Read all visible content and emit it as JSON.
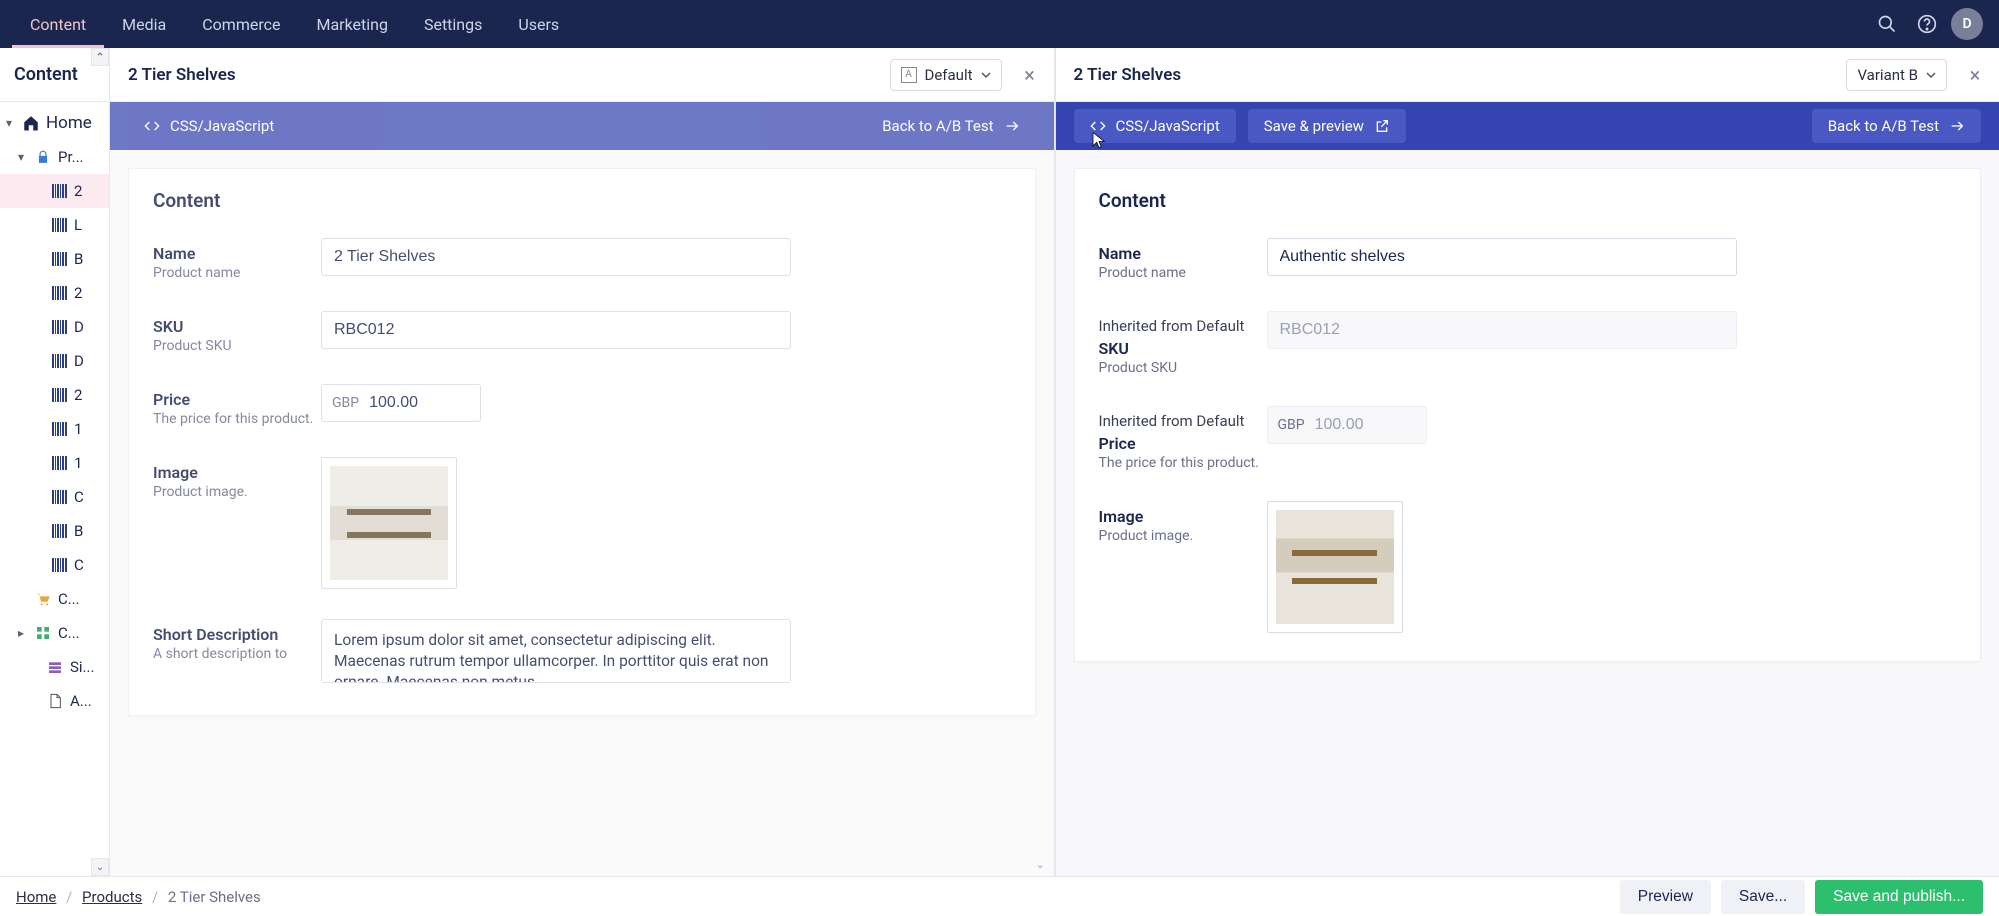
{
  "topnav": {
    "items": [
      "Content",
      "Media",
      "Commerce",
      "Marketing",
      "Settings",
      "Users"
    ],
    "active": 0,
    "avatar_initial": "D"
  },
  "sidebar": {
    "title": "Content",
    "home_label": "Home",
    "products_label": "Pr...",
    "children": [
      {
        "label": "2"
      },
      {
        "label": "L"
      },
      {
        "label": "B"
      },
      {
        "label": "2"
      },
      {
        "label": "D"
      },
      {
        "label": "D"
      },
      {
        "label": "2"
      },
      {
        "label": "1"
      },
      {
        "label": "1"
      },
      {
        "label": "C"
      },
      {
        "label": "B"
      },
      {
        "label": "C"
      }
    ],
    "extra": [
      {
        "icon": "cart",
        "label": "C..."
      },
      {
        "icon": "category",
        "label": "C..."
      },
      {
        "icon": "site",
        "label": "Si..."
      },
      {
        "icon": "doc",
        "label": "A..."
      }
    ]
  },
  "panes": {
    "left": {
      "title": "2 Tier Shelves",
      "variant_label": "Default",
      "bluebar": {
        "css_js": "CSS/JavaScript",
        "back": "Back to A/B Test"
      },
      "card_title": "Content",
      "fields": {
        "name_label": "Name",
        "name_sub": "Product name",
        "name_value": "2 Tier Shelves",
        "sku_label": "SKU",
        "sku_sub": "Product SKU",
        "sku_value": "RBC012",
        "price_label": "Price",
        "price_sub": "The price for this product.",
        "price_currency": "GBP",
        "price_value": "100.00",
        "image_label": "Image",
        "image_sub": "Product image.",
        "shortdesc_label": "Short Description",
        "shortdesc_sub": "A short description to",
        "shortdesc_value": "Lorem ipsum dolor sit amet, consectetur adipiscing elit. Maecenas rutrum tempor ullamcorper. In porttitor quis erat non ornare. Maecenas non metus"
      }
    },
    "right": {
      "title": "2 Tier Shelves",
      "variant_label": "Variant B",
      "bluebar": {
        "css_js": "CSS/JavaScript",
        "save_preview": "Save & preview",
        "back": "Back to A/B Test"
      },
      "card_title": "Content",
      "fields": {
        "name_label": "Name",
        "name_sub": "Product name",
        "name_value": "Authentic shelves",
        "inherited_label": "Inherited from Default",
        "sku_label": "SKU",
        "sku_sub": "Product SKU",
        "sku_value": "RBC012",
        "price_label": "Price",
        "price_sub": "The price for this product.",
        "price_currency": "GBP",
        "price_value": "100.00",
        "image_label": "Image",
        "image_sub": "Product image."
      }
    }
  },
  "footer": {
    "crumbs": [
      "Home",
      "Products",
      "2 Tier Shelves"
    ],
    "preview": "Preview",
    "save": "Save...",
    "publish": "Save and publish..."
  }
}
